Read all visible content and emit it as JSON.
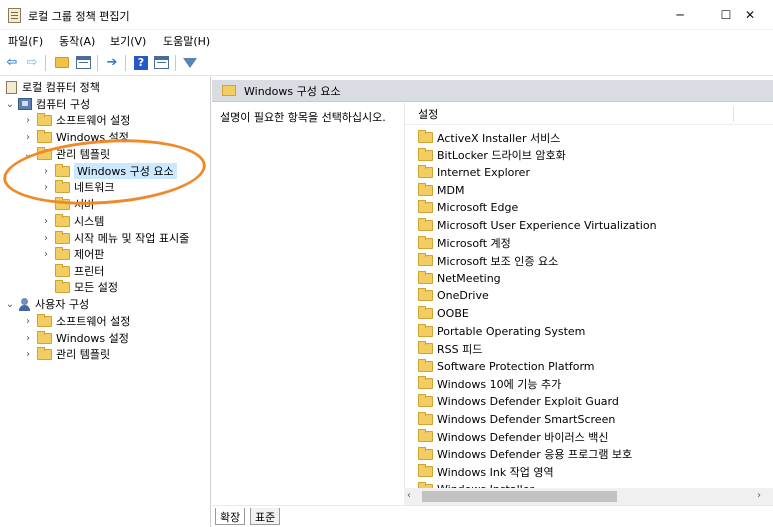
{
  "window": {
    "title": "로컬 그룹 정책 편집기",
    "controls": {
      "minimize": "─",
      "maximize": "☐",
      "close": "✕"
    }
  },
  "menu": [
    {
      "label": "파일(F)"
    },
    {
      "label": "동작(A)"
    },
    {
      "label": "보기(V)"
    },
    {
      "label": "도움말(H)"
    }
  ],
  "toolbar": {
    "back_glyph": "⇦",
    "forward_glyph": "⇨",
    "help_glyph": "?"
  },
  "tree": [
    {
      "label": "로컬 컴퓨터 정책",
      "icon": "policy-doc-icon",
      "chevron": ""
    },
    {
      "label": "컴퓨터 구성",
      "icon": "computer-icon",
      "chevron": "⌄"
    },
    {
      "label": "소프트웨어 설정",
      "icon": "folder-icon",
      "chevron": "›"
    },
    {
      "label": "Windows 설정",
      "icon": "folder-icon",
      "chevron": "›"
    },
    {
      "label": "관리 템플릿",
      "icon": "folder-icon",
      "chevron": "⌄"
    },
    {
      "label": "Windows 구성 요소",
      "icon": "folder-icon",
      "chevron": "›",
      "selected": true
    },
    {
      "label": "네트워크",
      "icon": "folder-icon",
      "chevron": "›"
    },
    {
      "label": "서버",
      "icon": "folder-icon",
      "chevron": ""
    },
    {
      "label": "시스템",
      "icon": "folder-icon",
      "chevron": "›"
    },
    {
      "label": "시작 메뉴 및 작업 표시줄",
      "icon": "folder-icon",
      "chevron": "›"
    },
    {
      "label": "제어판",
      "icon": "folder-icon",
      "chevron": "›"
    },
    {
      "label": "프린터",
      "icon": "folder-icon",
      "chevron": ""
    },
    {
      "label": "모든 설정",
      "icon": "folder-icon",
      "chevron": ""
    },
    {
      "label": "사용자 구성",
      "icon": "user-icon",
      "chevron": "⌄"
    },
    {
      "label": "소프트웨어 설정",
      "icon": "folder-icon",
      "chevron": "›"
    },
    {
      "label": "Windows 설정",
      "icon": "folder-icon",
      "chevron": "›"
    },
    {
      "label": "관리 템플릿",
      "icon": "folder-icon",
      "chevron": "›"
    }
  ],
  "right": {
    "header_title": "Windows 구성 요소",
    "description": "설명이 필요한 항목을 선택하십시오.",
    "column_header": "설정",
    "items": [
      "ActiveX Installer 서비스",
      "BitLocker 드라이브 암호화",
      "Internet Explorer",
      "MDM",
      "Microsoft Edge",
      "Microsoft User Experience Virtualization",
      "Microsoft 계정",
      "Microsoft 보조 인증 요소",
      "NetMeeting",
      "OneDrive",
      "OOBE",
      "Portable Operating System",
      "RSS 피드",
      "Software Protection Platform",
      "Windows 10에 기능 추가",
      "Windows Defender Exploit Guard",
      "Windows Defender SmartScreen",
      "Windows Defender 바이러스 백신",
      "Windows Defender 응용 프로그램 보호",
      "Windows Ink 작업 영역",
      "Windows Installer"
    ],
    "scroll_left": "‹",
    "scroll_right": "›"
  },
  "tabs": [
    {
      "label": "확장"
    },
    {
      "label": "표준"
    }
  ],
  "colors": {
    "annotation_ellipse": "#ef8a2b",
    "selection_highlight": "#cce8ff",
    "header_strip": "#d9dde3"
  }
}
